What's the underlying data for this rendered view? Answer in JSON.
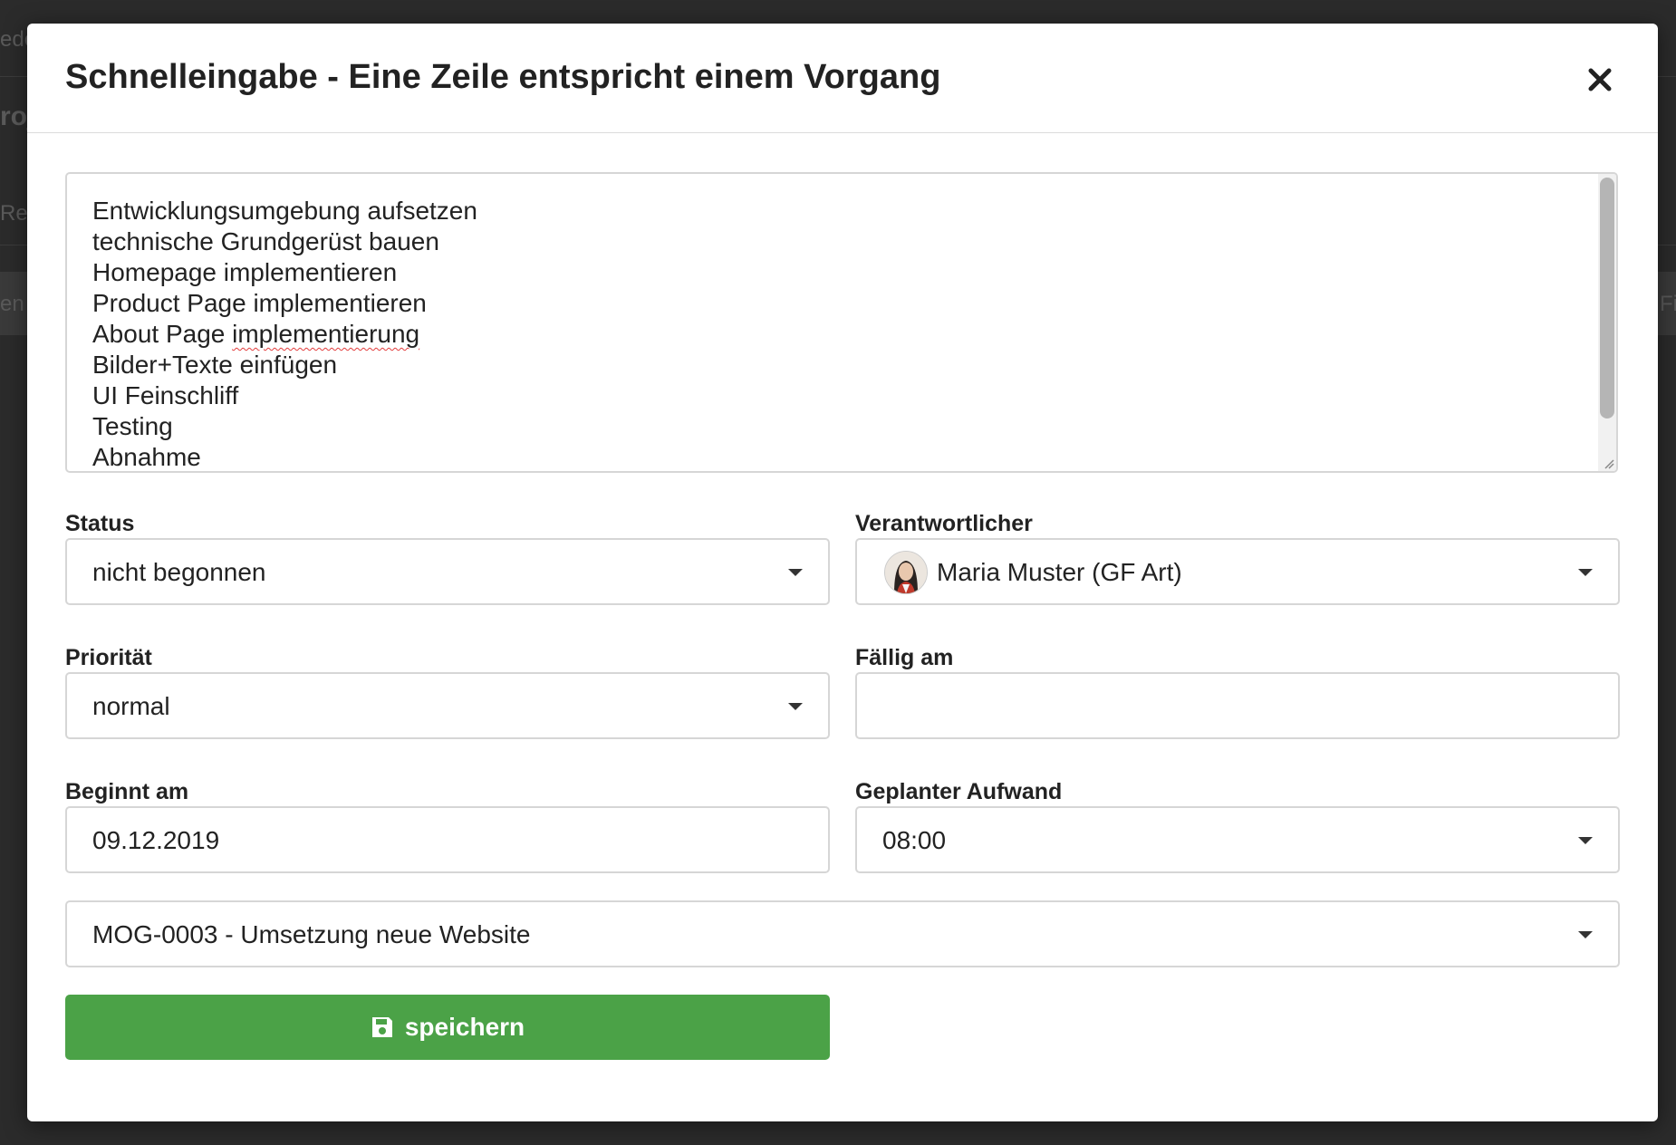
{
  "background": {
    "fragments": [
      "ede",
      "roj",
      "Re",
      "en",
      "Fi"
    ]
  },
  "modal": {
    "title": "Schnelleingabe - Eine Zeile entspricht einem Vorgang",
    "close_icon": "close-icon",
    "textarea": {
      "lines": [
        "Entwicklungsumgebung aufsetzen",
        "technische Grundgerüst bauen",
        "Homepage implementieren",
        "Product Page implementieren",
        "About Page implementierung",
        "Bilder+Texte einfügen",
        "UI Feinschliff",
        "Testing",
        "Abnahme"
      ]
    },
    "status": {
      "label": "Status",
      "value": "nicht begonnen"
    },
    "verantwortlicher": {
      "label": "Verantwortlicher",
      "value": "Maria Muster (GF Art)"
    },
    "prioritaet": {
      "label": "Priorität",
      "value": "normal"
    },
    "faellig": {
      "label": "Fällig am",
      "value": ""
    },
    "beginnt": {
      "label": "Beginnt am",
      "value": "09.12.2019"
    },
    "aufwand": {
      "label": "Geplanter Aufwand",
      "value": "08:00"
    },
    "projekt": {
      "value": "MOG-0003 - Umsetzung neue Website"
    },
    "save_button": {
      "label": "speichern",
      "icon": "save-icon",
      "color": "#4ba247"
    }
  }
}
